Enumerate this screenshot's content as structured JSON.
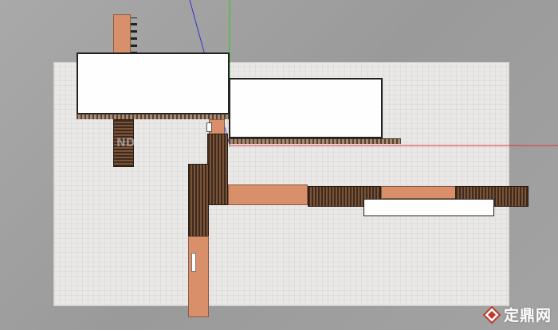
{
  "watermark": {
    "brand_text": "定鼎网",
    "faint_mark": "ND"
  },
  "colors": {
    "viewport_bg": "#9c9c9c",
    "ground": "#e9e8e6",
    "wall_white": "#fefefe",
    "terracotta": "#d88f6a",
    "wood_dark": "#3e2b1e",
    "axis_red": "#d33",
    "axis_green": "#2c2",
    "axis_blue": "#33c",
    "logo_red": "#c0392b"
  },
  "icons": {
    "logo": "diamond-logo-icon"
  }
}
